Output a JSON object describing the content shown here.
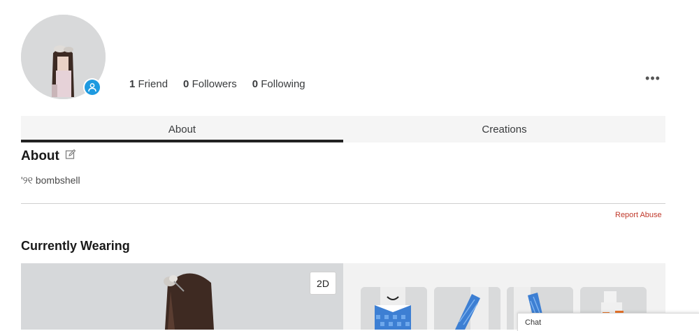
{
  "profile": {
    "stats": [
      {
        "count": "1",
        "label": "Friend"
      },
      {
        "count": "0",
        "label": "Followers"
      },
      {
        "count": "0",
        "label": "Following"
      }
    ],
    "more_label": "•••"
  },
  "tabs": [
    {
      "label": "About",
      "active": true
    },
    {
      "label": "Creations",
      "active": false
    }
  ],
  "about": {
    "title": "About",
    "bio": "'୨୧ bombshell",
    "report_label": "Report Abuse"
  },
  "wearing": {
    "title": "Currently Wearing",
    "toggle_label": "2D"
  },
  "chat": {
    "label": "Chat"
  },
  "colors": {
    "accent_blue": "#1e9ae0",
    "report_red": "#c0392b",
    "tab_underline": "#222222"
  }
}
